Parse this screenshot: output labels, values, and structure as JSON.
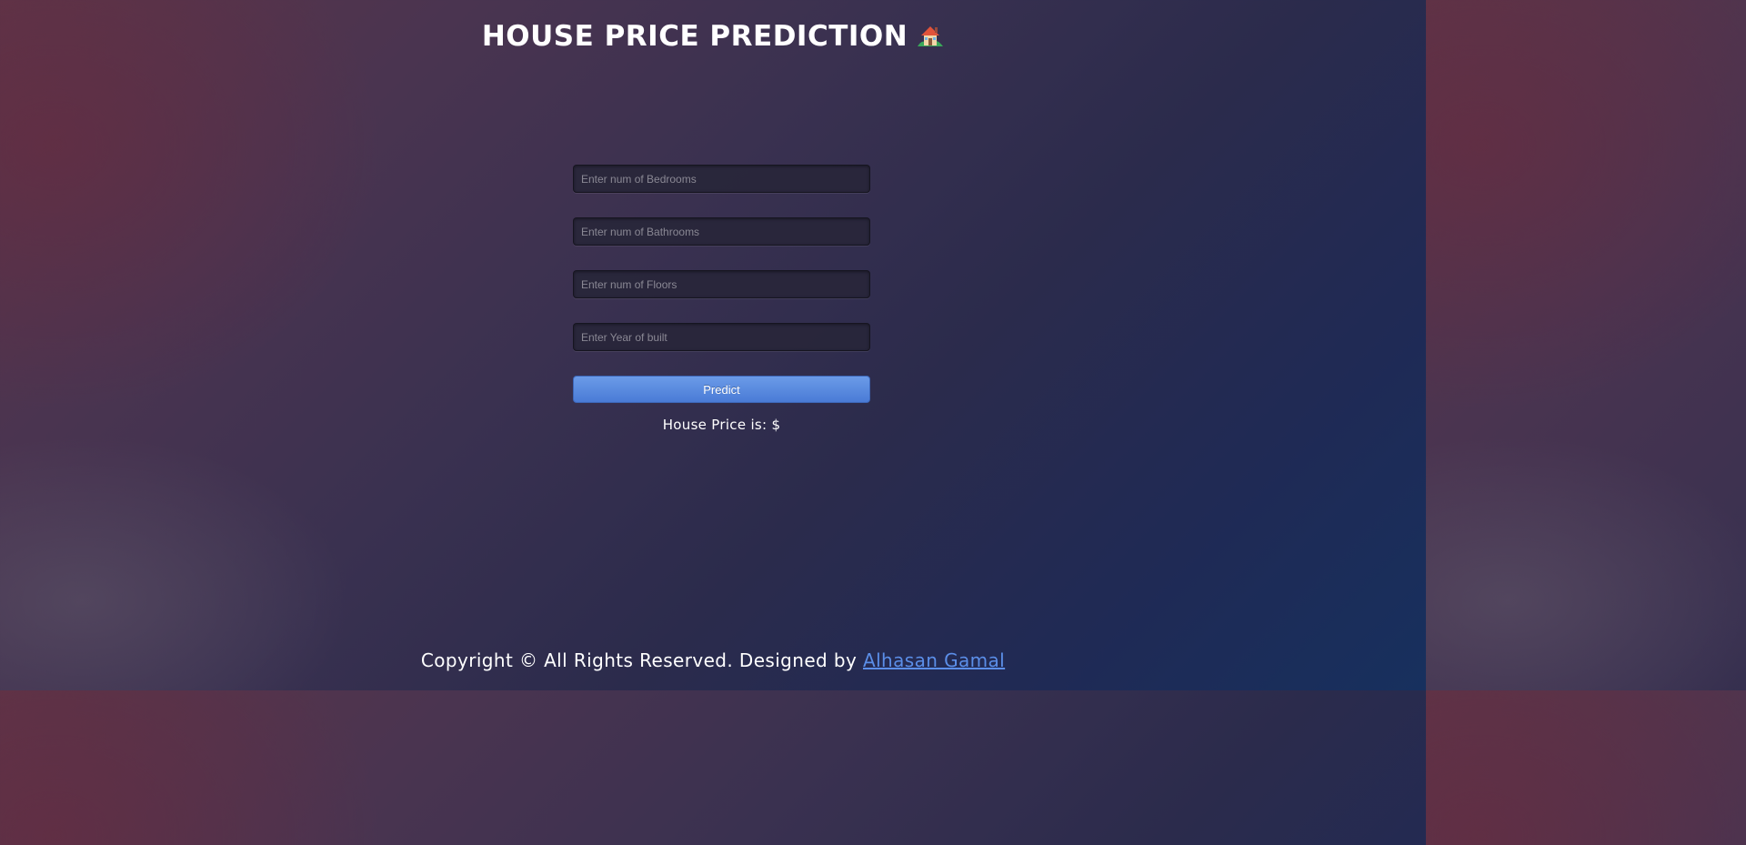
{
  "header": {
    "title": "HOUSE PRICE PREDICTION"
  },
  "form": {
    "bedrooms_placeholder": "Enter num of Bedrooms",
    "bathrooms_placeholder": "Enter num of Bathrooms",
    "floors_placeholder": "Enter num of Floors",
    "year_placeholder": "Enter Year of built",
    "predict_label": "Predict"
  },
  "result": {
    "text": "House Price is: $"
  },
  "footer": {
    "text": "Copyright © All Rights Reserved. Designed by ",
    "author": "Alhasan Gamal"
  },
  "colors": {
    "button": "#5a8ae0",
    "link": "#5b8ee8"
  },
  "icons": {
    "title_icon": "house-with-garden-icon"
  }
}
